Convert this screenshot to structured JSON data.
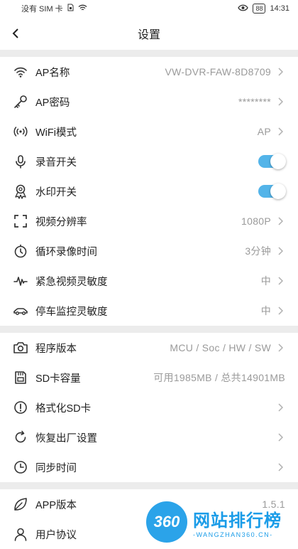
{
  "statusbar": {
    "carrier": "没有 SIM 卡",
    "battery": "88",
    "time": "14:31"
  },
  "navbar": {
    "title": "设置"
  },
  "sections": [
    [
      {
        "label": "AP名称",
        "value": "VW-DVR-FAW-8D8709",
        "icon": "wifi-icon",
        "chevron": true
      },
      {
        "label": "AP密码",
        "value": "********",
        "icon": "key-icon",
        "chevron": true
      },
      {
        "label": "WiFi模式",
        "value": "AP",
        "icon": "signal-broadcast-icon",
        "chevron": true
      },
      {
        "label": "录音开关",
        "toggle": true,
        "icon": "microphone-icon"
      },
      {
        "label": "水印开关",
        "toggle": true,
        "icon": "award-ribbon-icon"
      },
      {
        "label": "视频分辨率",
        "value": "1080P",
        "icon": "frame-corners-icon",
        "chevron": true
      },
      {
        "label": "循环录像时间",
        "value": "3分钟",
        "icon": "timer-icon",
        "chevron": true
      },
      {
        "label": "紧急视频灵敏度",
        "value": "中",
        "icon": "pulse-icon",
        "chevron": true
      },
      {
        "label": "停车监控灵敏度",
        "value": "中",
        "icon": "car-icon",
        "chevron": true
      }
    ],
    [
      {
        "label": "程序版本",
        "value": "MCU / Soc / HW / SW",
        "icon": "camera-icon",
        "chevron": true
      },
      {
        "label": "SD卡容量",
        "value": "可用1985MB / 总共14901MB",
        "icon": "sd-card-icon",
        "chevron": false
      },
      {
        "label": "格式化SD卡",
        "value": "",
        "icon": "alert-circle-icon",
        "chevron": true
      },
      {
        "label": "恢复出厂设置",
        "value": "",
        "icon": "refresh-icon",
        "chevron": true
      },
      {
        "label": "同步时间",
        "value": "",
        "icon": "clock-icon",
        "chevron": true
      }
    ],
    [
      {
        "label": "APP版本",
        "value": "1.5.1",
        "icon": "leaf-icon",
        "chevron": false
      },
      {
        "label": "用户协议",
        "value": "",
        "icon": "user-icon",
        "chevron": false
      }
    ]
  ],
  "watermark": {
    "logo": "360",
    "name": "网站排行榜",
    "url": "-WANGZHAN360.CN-"
  },
  "colors": {
    "toggle_on": "#53b4e9",
    "watermark": "#1a9ce8"
  }
}
